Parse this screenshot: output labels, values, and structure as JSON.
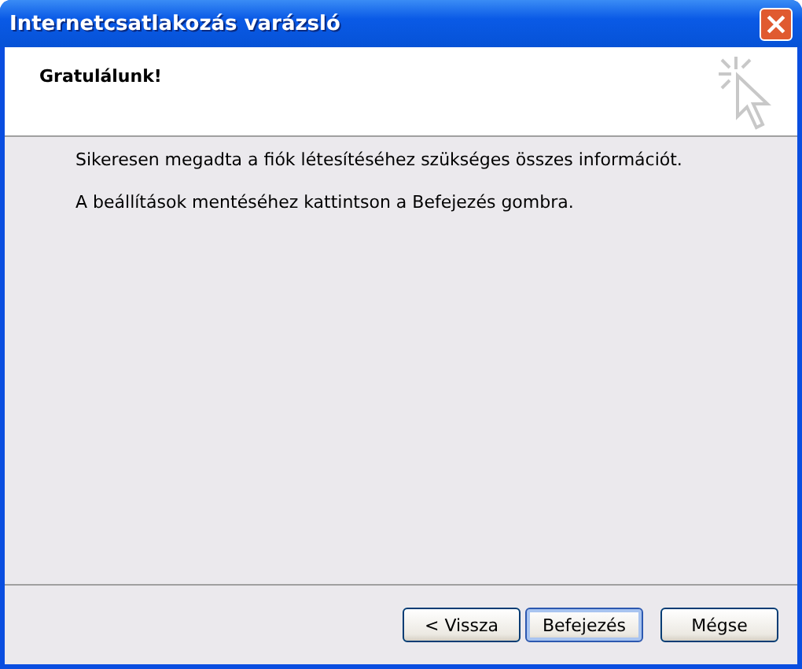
{
  "window": {
    "title": "Internetcsatlakozás varázsló"
  },
  "header": {
    "title": "Gratulálunk!"
  },
  "body": {
    "paragraphs": [
      "Sikeresen megadta a fiók létesítéséhez szükséges összes információt.",
      "A beállítások mentéséhez kattintson a Befejezés gombra."
    ]
  },
  "buttons": [
    {
      "label": "< Vissza",
      "default": false
    },
    {
      "label": "Befejezés",
      "default": true
    },
    {
      "label": "Mégse",
      "default": false
    }
  ]
}
